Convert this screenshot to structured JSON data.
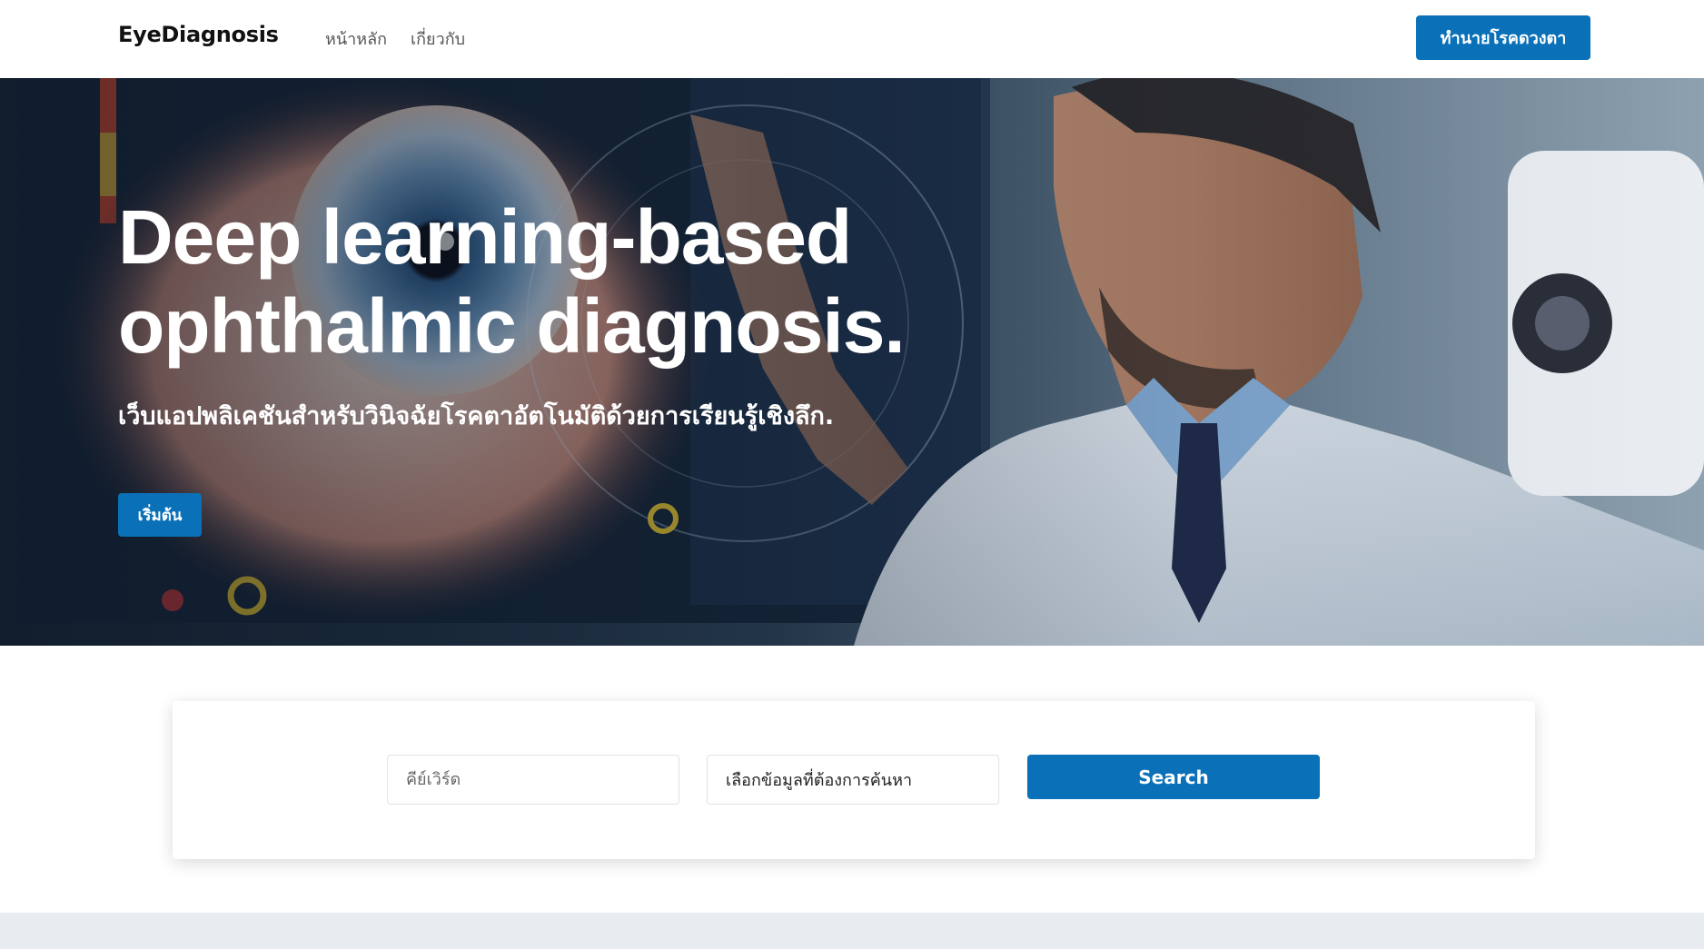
{
  "navbar": {
    "brand": "EyeDiagnosis",
    "links": [
      {
        "label": "หน้าหลัก"
      },
      {
        "label": "เกี่ยวกับ"
      }
    ],
    "cta_label": "ทำนายโรคดวงตา"
  },
  "hero": {
    "title": "Deep learning-based ophthalmic diagnosis.",
    "subtitle": "เว็บแอปพลิเคชันสำหรับวินิจฉัยโรคตาอัตโนมัติด้วยการเรียนรู้เชิงลึก.",
    "start_label": "เริ่มต้น"
  },
  "search": {
    "keyword_placeholder": "คีย์เวิร์ด",
    "select_value": "เลือกข้อมูลที่ต้องการค้นหา",
    "button_label": "Search"
  },
  "colors": {
    "accent": "#0a70b8",
    "footer_band": "#e8ecf0"
  }
}
